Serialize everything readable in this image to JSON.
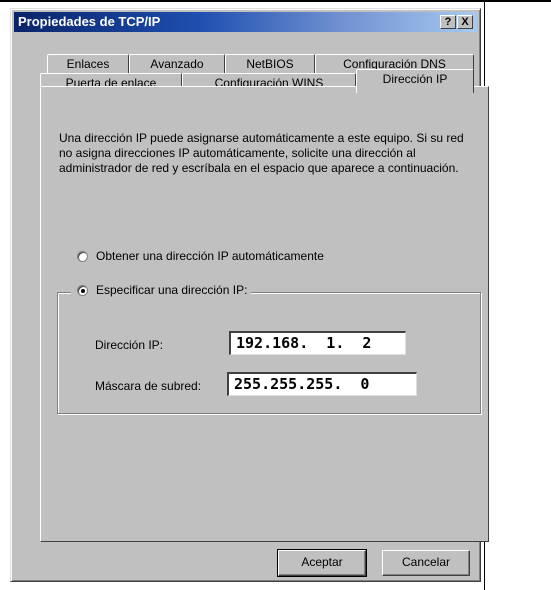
{
  "window": {
    "title": "Propiedades de TCP/IP",
    "help_label": "?",
    "close_label": "X"
  },
  "tabs": {
    "row1": [
      "Enlaces",
      "Avanzado",
      "NetBIOS",
      "Configuración DNS"
    ],
    "row2": [
      "Puerta de enlace",
      "Configuración WINS",
      "Dirección IP"
    ],
    "active": "Dirección IP"
  },
  "description": "Una dirección IP puede asignarse automáticamente a este equipo. Si su red no asigna direcciones IP automáticamente, solicite una dirección al administrador de red y escríbala en el espacio que aparece a continuación.",
  "options": {
    "auto_label": "Obtener una dirección IP automáticamente",
    "auto_selected": false,
    "manual_label": "Especificar una dirección IP:",
    "manual_selected": true
  },
  "fields": {
    "ip_label": "Dirección IP:",
    "ip_value": "192.168.  1.  2",
    "mask_label": "Máscara de subred:",
    "mask_value": "255.255.255.  0"
  },
  "buttons": {
    "ok_label": "Aceptar",
    "cancel_label": "Cancelar"
  },
  "colors": {
    "title_start": "#0a246a",
    "title_end": "#a6caf0",
    "face": "#c0c0c0"
  }
}
